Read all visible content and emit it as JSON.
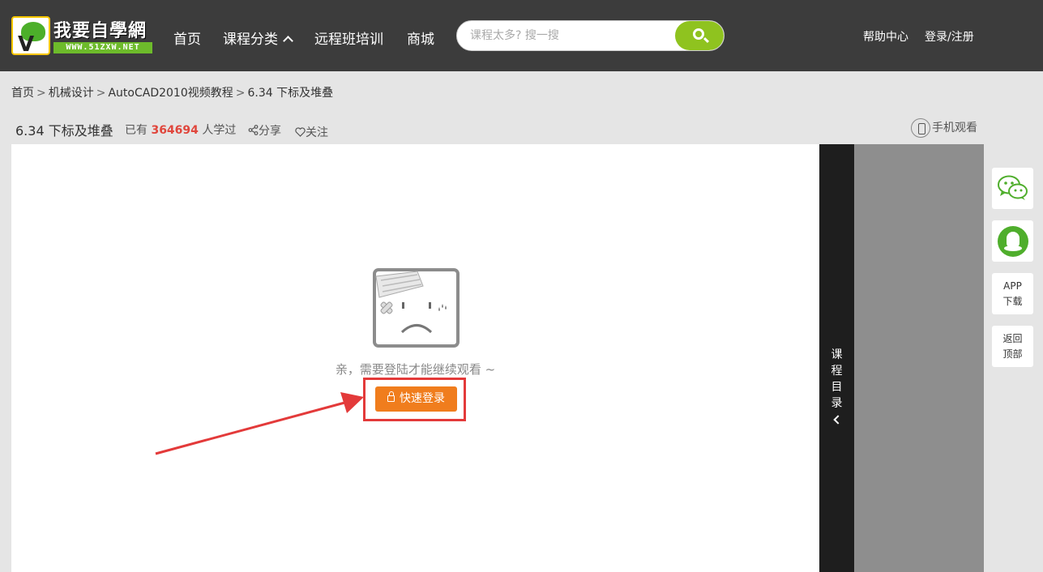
{
  "site": {
    "logo_name": "我要自學網",
    "logo_url": "WWW.51ZXW.NET"
  },
  "nav": {
    "home": "首页",
    "categories": "课程分类",
    "remote": "远程班培训",
    "mall": "商城"
  },
  "search": {
    "placeholder": "课程太多? 搜一搜"
  },
  "top_right": {
    "help": "帮助中心",
    "login": "登录/注册"
  },
  "breadcrumb": {
    "items": [
      "首页",
      "机械设计",
      "AutoCAD2010视频教程",
      "6.34 下标及堆叠"
    ],
    "separator": ">"
  },
  "lesson": {
    "title": "6.34 下标及堆叠",
    "learners_prefix": "已有",
    "learners_count": "364694",
    "learners_suffix": "人学过",
    "share": "分享",
    "follow": "关注",
    "mobile": "手机观看"
  },
  "player": {
    "prompt": "亲，需要登陆才能继续观看 ~",
    "login_button": "快速登录"
  },
  "catalog": {
    "label": [
      "课",
      "程",
      "目",
      "录"
    ]
  },
  "float_bar": {
    "app_line1": "APP",
    "app_line2": "下载",
    "top_line1": "返回",
    "top_line2": "顶部"
  },
  "icons": {
    "search": "search-icon",
    "up_chevron": "chevron-up-icon",
    "share": "share-icon",
    "heart": "heart-icon",
    "phone": "phone-icon",
    "lock": "lock-icon",
    "wechat": "wechat-icon",
    "qq": "qq-icon"
  },
  "colors": {
    "header_bg": "#3c3c3c",
    "search_btn": "#8fc31f",
    "login_btn": "#f07d1d",
    "learner_count": "#e0463c",
    "highlight": "#e33a3a"
  }
}
